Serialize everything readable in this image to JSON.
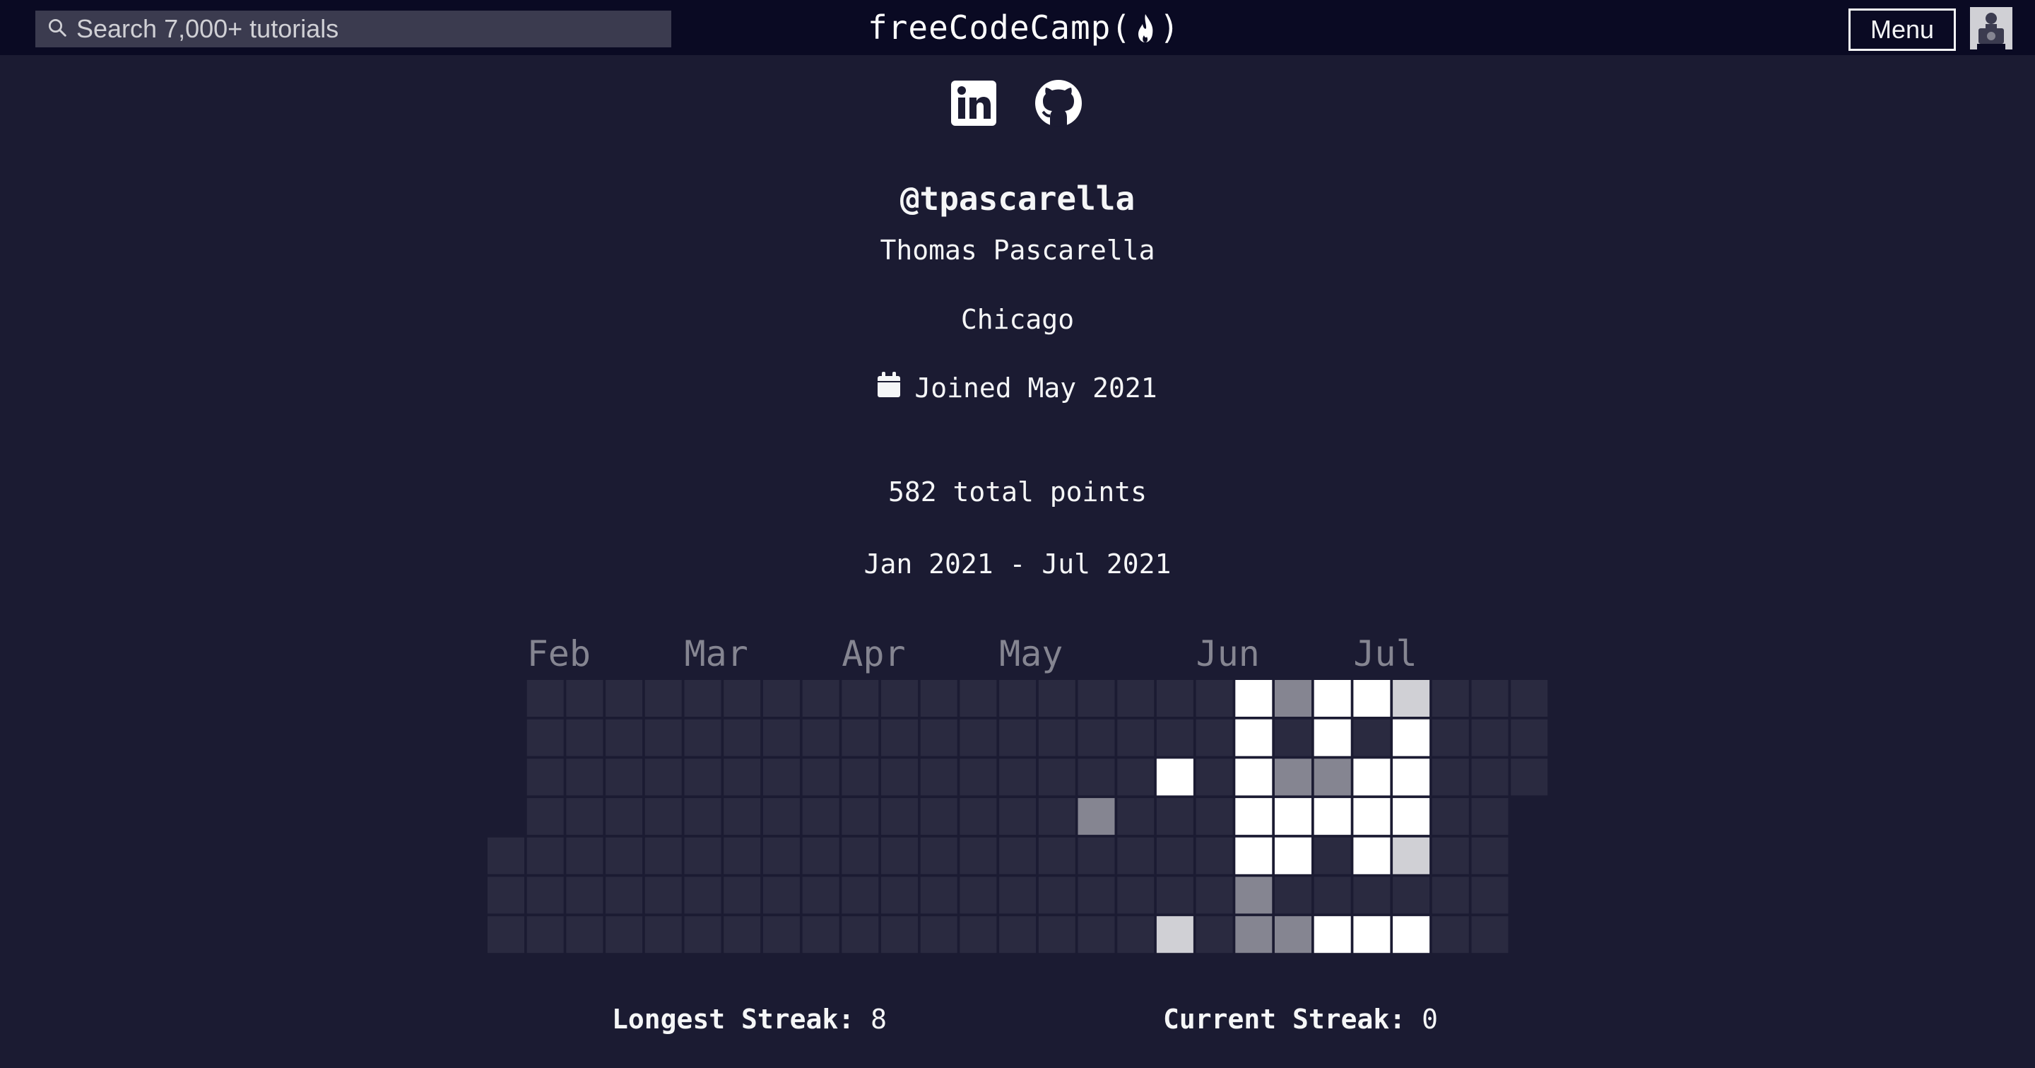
{
  "navbar": {
    "search_placeholder": "Search 7,000+ tutorials",
    "logo_text": "freeCodeCamp",
    "menu_label": "Menu"
  },
  "profile": {
    "username": "@tpascarella",
    "name": "Thomas Pascarella",
    "location": "Chicago",
    "joined": "Joined May 2021",
    "points": "582 total points",
    "range": "Jan 2021 - Jul 2021"
  },
  "heatmap": {
    "months": [
      "Feb",
      "Mar",
      "Apr",
      "May",
      "Jun",
      "Jul"
    ],
    "colors": {
      "0": "#2a2a40",
      "1": "#858591",
      "2": "#d0d0d5",
      "3": "#ffffff"
    },
    "rows": [
      [
        null,
        0,
        0,
        0,
        0,
        0,
        0,
        0,
        0,
        0,
        0,
        0,
        0,
        0,
        0,
        0,
        0,
        0,
        0,
        3,
        1,
        3,
        3,
        2,
        0,
        0,
        0
      ],
      [
        null,
        0,
        0,
        0,
        0,
        0,
        0,
        0,
        0,
        0,
        0,
        0,
        0,
        0,
        0,
        0,
        0,
        0,
        0,
        3,
        0,
        3,
        0,
        3,
        0,
        0,
        0
      ],
      [
        null,
        0,
        0,
        0,
        0,
        0,
        0,
        0,
        0,
        0,
        0,
        0,
        0,
        0,
        0,
        0,
        0,
        3,
        0,
        3,
        1,
        1,
        3,
        3,
        0,
        0,
        0
      ],
      [
        null,
        0,
        0,
        0,
        0,
        0,
        0,
        0,
        0,
        0,
        0,
        0,
        0,
        0,
        0,
        1,
        0,
        0,
        0,
        3,
        3,
        3,
        3,
        3,
        0,
        0,
        null
      ],
      [
        0,
        0,
        0,
        0,
        0,
        0,
        0,
        0,
        0,
        0,
        0,
        0,
        0,
        0,
        0,
        0,
        0,
        0,
        0,
        3,
        3,
        0,
        3,
        2,
        0,
        0,
        null
      ],
      [
        0,
        0,
        0,
        0,
        0,
        0,
        0,
        0,
        0,
        0,
        0,
        0,
        0,
        0,
        0,
        0,
        0,
        0,
        0,
        1,
        0,
        0,
        0,
        0,
        0,
        0,
        null
      ],
      [
        0,
        0,
        0,
        0,
        0,
        0,
        0,
        0,
        0,
        0,
        0,
        0,
        0,
        0,
        0,
        0,
        0,
        2,
        0,
        1,
        1,
        3,
        3,
        3,
        0,
        0,
        null
      ]
    ]
  },
  "streaks": {
    "longest_label": "Longest Streak:",
    "longest_value": "8",
    "current_label": "Current Streak:",
    "current_value": "0"
  }
}
